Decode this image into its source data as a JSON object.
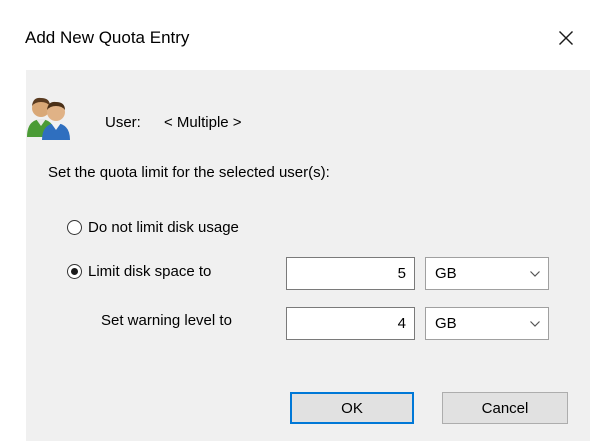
{
  "dialog": {
    "title": "Add New Quota Entry",
    "close_glyph": "✕"
  },
  "user": {
    "label": "User:",
    "value": "< Multiple >",
    "icon": "users-icon"
  },
  "prompt": "Set the quota limit for the selected user(s):",
  "options": {
    "no_limit": {
      "label": "Do not limit disk usage",
      "selected": false
    },
    "limit": {
      "label": "Limit disk space to",
      "selected": true
    }
  },
  "limit_space": {
    "value": "5",
    "unit": "GB"
  },
  "warning_level": {
    "label": "Set warning level to",
    "value": "4",
    "unit": "GB"
  },
  "buttons": {
    "ok": "OK",
    "cancel": "Cancel"
  },
  "colors": {
    "client_background": "#f0f0f0",
    "default_button_border": "#0078d7"
  }
}
